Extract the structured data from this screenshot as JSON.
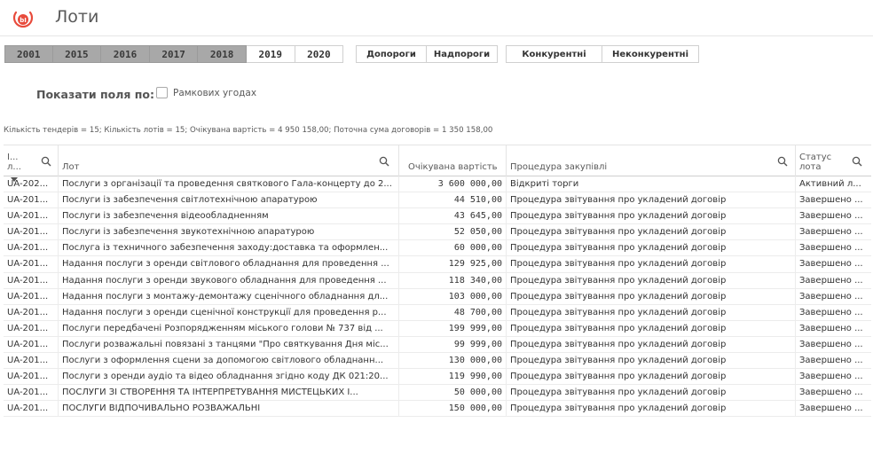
{
  "header": {
    "title": "Лоти",
    "logo_icon": "qlik-logo-icon"
  },
  "filters": {
    "years": [
      {
        "label": "2001",
        "selected": true
      },
      {
        "label": "2015",
        "selected": true
      },
      {
        "label": "2016",
        "selected": true
      },
      {
        "label": "2017",
        "selected": true
      },
      {
        "label": "2018",
        "selected": true
      },
      {
        "label": "2019",
        "selected": false
      },
      {
        "label": "2020",
        "selected": false
      }
    ],
    "threshold": [
      "Допороги",
      "Надпороги"
    ],
    "competition": [
      "Конкурентні",
      "Неконкурентні"
    ],
    "show_fields_label": "Показати поля по:",
    "checkbox_label": "Рамкових угодах"
  },
  "summary": "Кількість тендерів = 15; Кількість лотів = 15; Очікувана вартість = 4 950 158,00; Поточна сума договорів = 1 350 158,00",
  "table": {
    "columns": {
      "id": "I... л...",
      "lot": "Лот",
      "expected": "Очікувана вартість",
      "procedure": "Процедура закупівлі",
      "status": "Статус лота"
    },
    "rows": [
      {
        "id": "UA-202...",
        "lot": "Послуги з організації та проведення святкового Гала-концерту до 2...",
        "expected": "3 600 000,00",
        "procedure": "Відкриті торги",
        "status": "Активний л..."
      },
      {
        "id": "UA-201...",
        "lot": "Послуги із забезпечення світлотехнічною апаратурою",
        "expected": "44 510,00",
        "procedure": "Процедура звітування про укладений договір",
        "status": "Завершено ..."
      },
      {
        "id": "UA-201...",
        "lot": "Послуги із забезпечення відеообладненням",
        "expected": "43 645,00",
        "procedure": "Процедура звітування про укладений договір",
        "status": "Завершено ..."
      },
      {
        "id": "UA-201...",
        "lot": "Послуги із забезпечення звукотехнічною апаратурою",
        "expected": "52 050,00",
        "procedure": "Процедура звітування про укладений договір",
        "status": "Завершено ..."
      },
      {
        "id": "UA-201...",
        "lot": "Послуга із техничного забезпечення заходу:доставка та оформлен...",
        "expected": "60 000,00",
        "procedure": "Процедура звітування про укладений договір",
        "status": "Завершено ..."
      },
      {
        "id": "UA-201...",
        "lot": "Надання послуги з оренди світлового обладнання для проведення ...",
        "expected": "129 925,00",
        "procedure": "Процедура звітування про укладений договір",
        "status": "Завершено ..."
      },
      {
        "id": "UA-201...",
        "lot": "Надання послуги з оренди звукового обладнання для проведення ...",
        "expected": "118 340,00",
        "procedure": "Процедура звітування про укладений договір",
        "status": "Завершено ..."
      },
      {
        "id": "UA-201...",
        "lot": "Надання послуги з монтажу-демонтажу сценічного обладнання дл...",
        "expected": "103 000,00",
        "procedure": "Процедура звітування про укладений договір",
        "status": "Завершено ..."
      },
      {
        "id": "UA-201...",
        "lot": "Надання послуги з оренди сценічної конструкції для проведення р...",
        "expected": "48 700,00",
        "procedure": "Процедура звітування про укладений договір",
        "status": "Завершено ..."
      },
      {
        "id": "UA-201...",
        "lot": "Послуги передбачені Розпорядженням міського голови № 737 від ...",
        "expected": "199 999,00",
        "procedure": "Процедура звітування про укладений договір",
        "status": "Завершено ..."
      },
      {
        "id": "UA-201...",
        "lot": "Послуги розважальні повязані з танцями \"Про святкування Дня міс...",
        "expected": "99 999,00",
        "procedure": "Процедура звітування про укладений договір",
        "status": "Завершено ..."
      },
      {
        "id": "UA-201...",
        "lot": "Послуги з оформлення сцени за допомогою світлового обладнанн...",
        "expected": "130 000,00",
        "procedure": "Процедура звітування про укладений договір",
        "status": "Завершено ..."
      },
      {
        "id": "UA-201...",
        "lot": "Послуги з оренди аудіо та відео обладнання згідно коду ДК 021:20...",
        "expected": "119 990,00",
        "procedure": "Процедура звітування про укладений договір",
        "status": "Завершено ..."
      },
      {
        "id": "UA-201...",
        "lot": "ПОСЛУГИ ЗІ СТВОРЕННЯ ТА ІНТЕРПРЕТУВАННЯ МИСТЕЦЬКИХ І...",
        "expected": "50 000,00",
        "procedure": "Процедура звітування про укладений договір",
        "status": "Завершено ..."
      },
      {
        "id": "UA-201...",
        "lot": "ПОСЛУГИ ВІДПОЧИВАЛЬНО РОЗВАЖАЛЬНІ",
        "expected": "150 000,00",
        "procedure": "Процедура звітування про укладений договір",
        "status": "Завершено ..."
      }
    ]
  }
}
